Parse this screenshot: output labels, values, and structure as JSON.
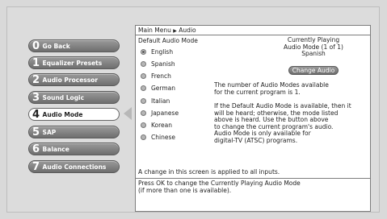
{
  "menu": {
    "items": [
      {
        "num": "0",
        "label": "Go Back"
      },
      {
        "num": "1",
        "label": "Equalizer Presets"
      },
      {
        "num": "2",
        "label": "Audio Processor"
      },
      {
        "num": "3",
        "label": "Sound Logic"
      },
      {
        "num": "4",
        "label": "Audio Mode"
      },
      {
        "num": "5",
        "label": "SAP"
      },
      {
        "num": "6",
        "label": "Balance"
      },
      {
        "num": "7",
        "label": "Audio Connections"
      }
    ],
    "active_index": 4
  },
  "breadcrumb": {
    "root": "Main Menu",
    "separator": "▶",
    "current": "Audio"
  },
  "default_audio_mode": {
    "label": "Default Audio Mode",
    "options": [
      "English",
      "Spanish",
      "French",
      "German",
      "Italian",
      "Japanese",
      "Korean",
      "Chinese"
    ],
    "selected": "English"
  },
  "currently_playing": {
    "line1": "Currently Playing",
    "line2": "Audio Mode (1 of 1)",
    "value": "Spanish",
    "button_label": "Change Audio"
  },
  "info": {
    "para1_line1": "The number of Audio Modes available",
    "para1_line2": "for the current program is 1.",
    "para2_lines": [
      "If the Default Audio Mode is available, then it",
      "will be heard; otherwise, the mode listed",
      "above is heard. Use the button above",
      "to change the current program's audio.",
      "Audio Mode is only available for",
      "digital-TV (ATSC) programs."
    ]
  },
  "footer": {
    "note": "A change in this screen is applied to all inputs.",
    "instruction_line1": "Press OK to change the Currently Playing Audio Mode",
    "instruction_line2": "(if more than one is available)."
  }
}
